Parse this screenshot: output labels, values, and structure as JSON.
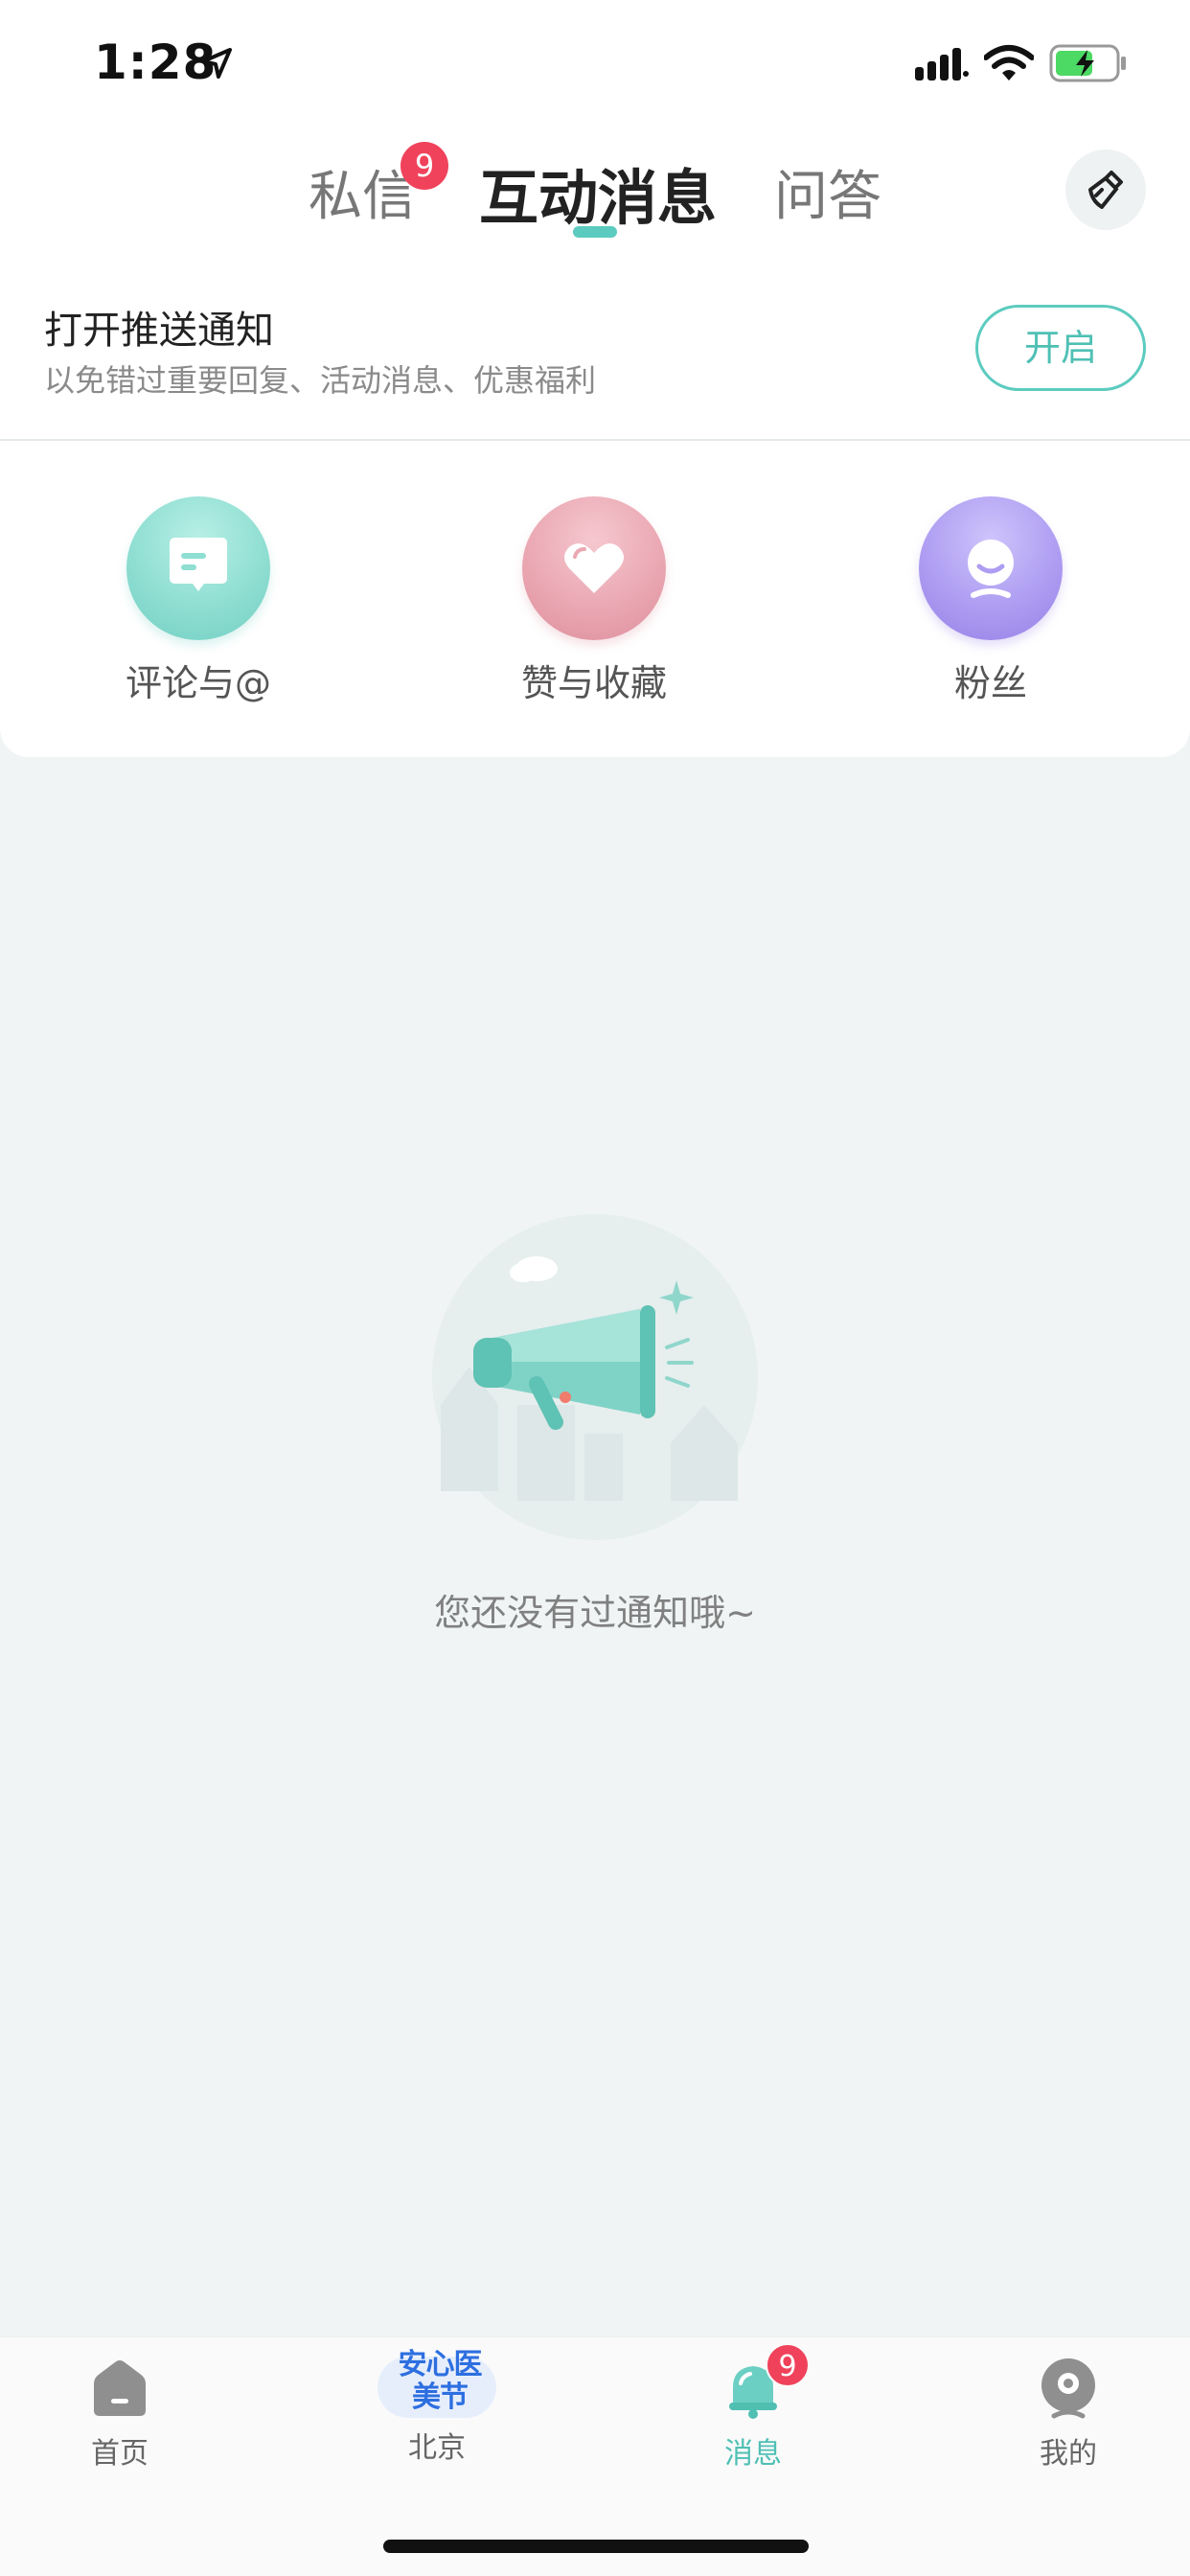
{
  "status_bar": {
    "time": "1:28"
  },
  "header": {
    "tabs": [
      {
        "label": "私信",
        "badge": "9"
      },
      {
        "label": "互动消息"
      },
      {
        "label": "问答"
      }
    ]
  },
  "push_banner": {
    "title": "打开推送通知",
    "subtitle": "以免错过重要回复、活动消息、优惠福利",
    "button_label": "开启"
  },
  "categories": [
    {
      "label": "评论与@",
      "icon": "comment-icon"
    },
    {
      "label": "赞与收藏",
      "icon": "heart-icon"
    },
    {
      "label": "粉丝",
      "icon": "fan-icon"
    }
  ],
  "empty_state": {
    "text": "您还没有过通知哦~",
    "icon": "megaphone-icon"
  },
  "bottom_nav": {
    "items": [
      {
        "label": "首页",
        "icon": "home-icon"
      },
      {
        "label": "北京",
        "icon": "festival-logo",
        "logo_text": "安心医美节"
      },
      {
        "label": "消息",
        "icon": "bell-icon",
        "badge": "9",
        "active": true
      },
      {
        "label": "我的",
        "icon": "profile-icon"
      }
    ]
  },
  "colors": {
    "accent": "#5ccbbf",
    "badge": "#f0425b",
    "background": "#f0f4f5"
  }
}
